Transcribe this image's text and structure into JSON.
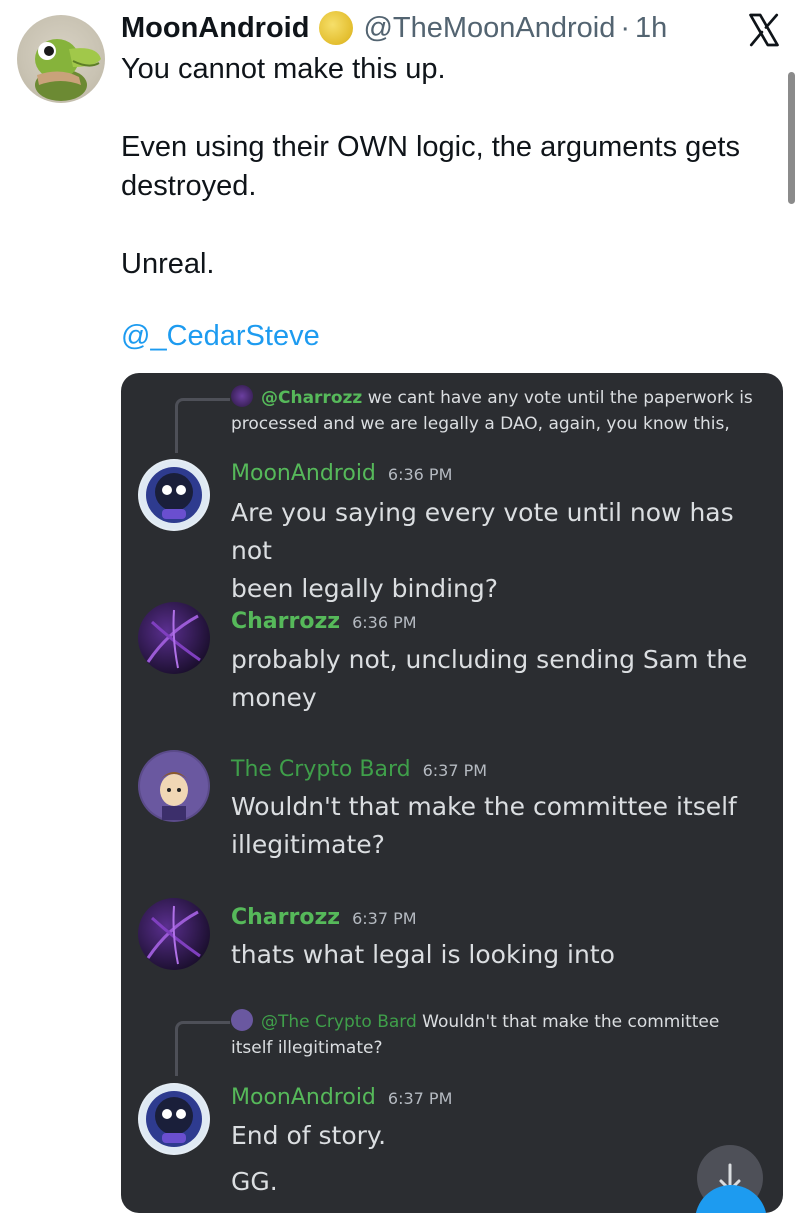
{
  "tweet": {
    "author_name": "MoonAndroid",
    "handle": "@TheMoonAndroid",
    "separator": "·",
    "time_ago": "1h",
    "paragraphs": [
      "You cannot make this up.",
      "Even using their OWN logic, the arguments gets destroyed.",
      "Unreal."
    ],
    "mention": "@_CedarSteve"
  },
  "discord": {
    "reply1": {
      "mention": "@Charrozz",
      "text": "we cant have any vote until the paperwork is processed and we are legally a DAO, again, you know this,"
    },
    "messages": [
      {
        "name": "MoonAndroid",
        "time": "6:36 PM",
        "lines": [
          "Are you saying every vote until now has not",
          "been legally binding?"
        ]
      },
      {
        "name": "Charrozz",
        "time": "6:36 PM",
        "lines": [
          "probably not, uncluding sending Sam the",
          "money"
        ]
      },
      {
        "name": "The Crypto Bard",
        "time": "6:37 PM",
        "lines": [
          "Wouldn't that make the committee itself",
          "illegitimate?"
        ]
      },
      {
        "name": "Charrozz",
        "time": "6:37 PM",
        "lines": [
          "thats what legal is looking into"
        ]
      },
      {
        "name": "MoonAndroid",
        "time": "6:37 PM",
        "lines": [
          "End of story.",
          "GG."
        ]
      }
    ],
    "reply2": {
      "mention": "@The Crypto Bard",
      "text": "Wouldn't that make the committee itself illegitimate?"
    }
  },
  "icons": {
    "platform_logo": "x-logo-icon",
    "verified_badge": "moon-badge-icon",
    "scroll_button": "arrow-down-icon"
  },
  "colors": {
    "link": "#1d9bf0",
    "discord_bg": "#2b2d31",
    "name_green": "#56b95a",
    "bard_name": "#3f9f4a"
  }
}
